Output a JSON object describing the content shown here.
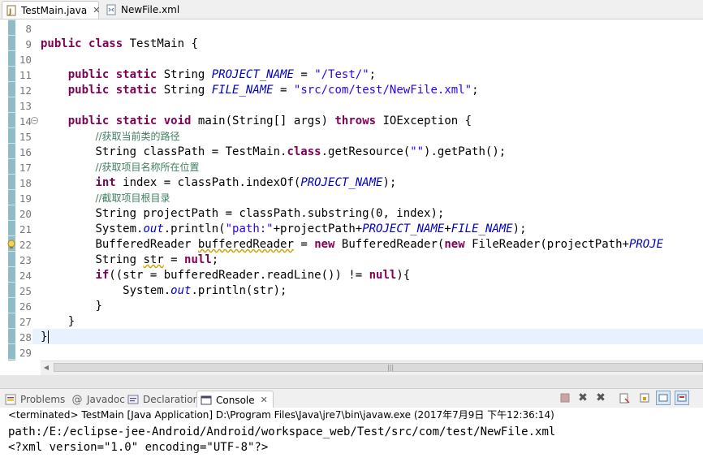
{
  "editor_tabs": [
    {
      "label": "TestMain.java",
      "icon": "java-file-icon",
      "active": true
    },
    {
      "label": "NewFile.xml",
      "icon": "xml-file-icon",
      "active": false
    }
  ],
  "line_numbers": [
    "8",
    "9",
    "10",
    "11",
    "12",
    "13",
    "14",
    "15",
    "16",
    "17",
    "18",
    "19",
    "20",
    "21",
    "22",
    "23",
    "24",
    "25",
    "26",
    "27",
    "28",
    "29"
  ],
  "code": {
    "l9": {
      "kw1": "public",
      "kw2": "class",
      "name": " TestMain {"
    },
    "l11": {
      "kw1": "public",
      "kw2": "static",
      "type": " String ",
      "field": "PROJECT_NAME",
      "eq": " = ",
      "str": "\"/Test/\"",
      "end": ";"
    },
    "l12": {
      "kw1": "public",
      "kw2": "static",
      "type": " String ",
      "field": "FILE_NAME",
      "eq": " = ",
      "str": "\"src/com/test/NewFile.xml\"",
      "end": ";"
    },
    "l14": {
      "kw1": "public",
      "kw2": "static",
      "kw3": "void",
      "mid": " main(String[] args) ",
      "kw4": "throws",
      "end": " IOException {"
    },
    "l15": {
      "comment": "//获取当前类的路径"
    },
    "l16": {
      "a": "String classPath = TestMain.",
      "kw": "class",
      "b": ".getResource(",
      "str": "\"\"",
      "c": ").getPath();"
    },
    "l17": {
      "comment": "//获取项目名称所在位置"
    },
    "l18": {
      "kw": "int",
      "a": " index = classPath.indexOf(",
      "field": "PROJECT_NAME",
      "b": ");"
    },
    "l19": {
      "comment": "//截取项目根目录"
    },
    "l20": {
      "text": "String projectPath = classPath.substring(0, index);"
    },
    "l21": {
      "a": "System.",
      "out": "out",
      "b": ".println(",
      "str": "\"path:\"",
      "c": "+projectPath+",
      "f1": "PROJECT_NAME",
      "plus": "+",
      "f2": "FILE_NAME",
      "d": ");"
    },
    "l22": {
      "a": "BufferedReader ",
      "var": "bufferedReader",
      "b": " = ",
      "kw1": "new",
      "c": " BufferedReader(",
      "kw2": "new",
      "d": " FileReader(projectPath+",
      "field": "PROJE"
    },
    "l23": {
      "a": "String ",
      "var": "str",
      "b": " = ",
      "kw": "null",
      "c": ";"
    },
    "l24": {
      "kw": "if",
      "a": "((str = bufferedReader.readLine()) != ",
      "kw2": "null",
      "b": "){"
    },
    "l25": {
      "a": "System.",
      "out": "out",
      "b": ".println(str);"
    },
    "l26": {
      "text": "}"
    },
    "l27": {
      "text": "}"
    },
    "l28": {
      "text": "}"
    }
  },
  "console": {
    "tabs": [
      {
        "label": "Problems",
        "icon": "problems-icon"
      },
      {
        "label": "Javadoc",
        "icon": "javadoc-icon"
      },
      {
        "label": "Declaration",
        "icon": "declaration-icon"
      },
      {
        "label": "Console",
        "icon": "console-icon",
        "active": true
      }
    ],
    "header": "<terminated> TestMain [Java Application] D:\\Program Files\\Java\\jre7\\bin\\javaw.exe (2017年7月9日 下午12:36:14)",
    "output": [
      "path:/E:/eclipse-jee-Android/Android/workspace_web/Test/src/com/test/NewFile.xml",
      "<?xml version=\"1.0\" encoding=\"UTF-8\"?>"
    ]
  },
  "colors": {
    "keyword": "#7f0055",
    "string": "#2a00ff",
    "field": "#0000c0",
    "comment": "#3f7f5f"
  }
}
